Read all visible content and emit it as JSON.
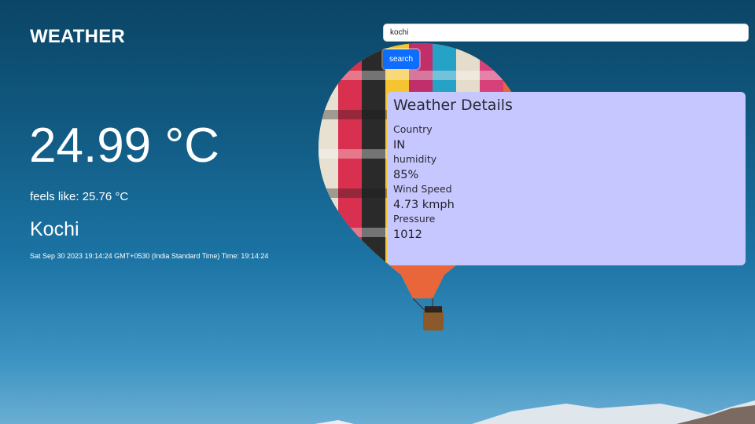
{
  "header": {
    "title": "WEATHER"
  },
  "current": {
    "temperature": "24.99 °C",
    "feels_like": "feels like: 25.76 °C",
    "city": "Kochi",
    "datetime": "Sat Sep 30 2023 19:14:24 GMT+0530 (India Standard Time) Time: 19:14:24"
  },
  "search": {
    "value": "kochi",
    "button_label": "search"
  },
  "details": {
    "title": "Weather Details",
    "items": [
      {
        "label": "Country",
        "value": "IN"
      },
      {
        "label": "humidity",
        "value": "85%"
      },
      {
        "label": "Wind Speed",
        "value": "4.73 kmph"
      },
      {
        "label": "Pressure",
        "value": "1012"
      }
    ]
  },
  "colors": {
    "accent": "#0d6efd",
    "card_background": "#c7c7ff",
    "sky_top": "#0b4566",
    "sky_bottom": "#6aaed4"
  }
}
